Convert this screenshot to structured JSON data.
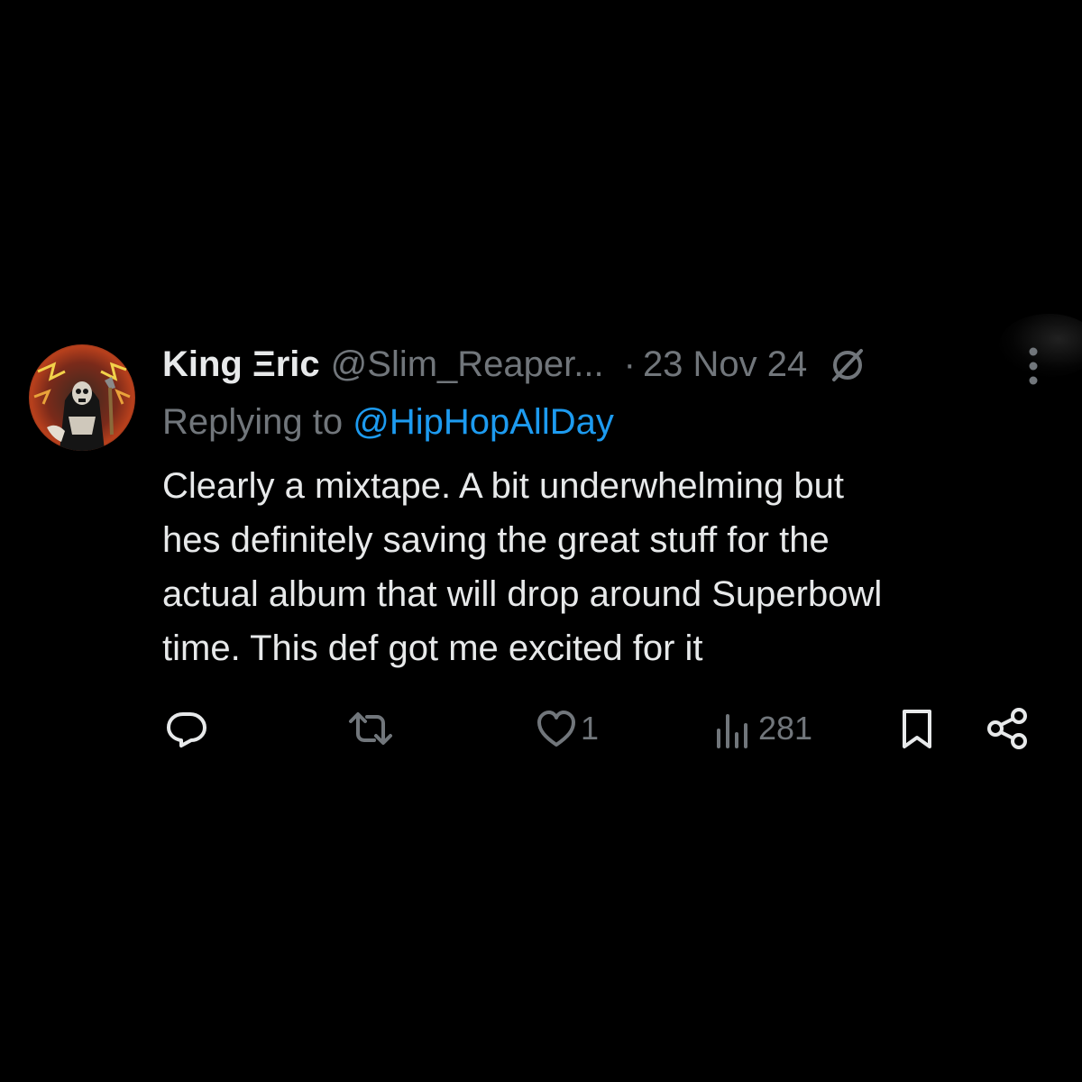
{
  "tweet": {
    "display_name": "King Ξric",
    "handle": "@Slim_Reaper...",
    "separator": "·",
    "date": "23 Nov 24",
    "reply_prefix": "Replying to",
    "reply_target": "@HipHopAllDay",
    "body_lines": [
      "Clearly a mixtape. A bit underwhelming but",
      "hes definitely saving the great stuff for the",
      "actual album that will drop around Superbowl",
      "time. This def got me excited for it"
    ]
  },
  "actions": {
    "reply": {
      "icon": "reply-icon"
    },
    "repost": {
      "icon": "repost-icon"
    },
    "like": {
      "icon": "heart-icon",
      "count": "1"
    },
    "views": {
      "icon": "views-icon",
      "count": "281"
    },
    "bookmark": {
      "icon": "bookmark-icon"
    },
    "share": {
      "icon": "share-icon"
    }
  },
  "icons": {
    "grok": "grok-icon",
    "more": "more-vertical-icon"
  },
  "colors": {
    "background": "#000000",
    "text_primary": "#e7e9ea",
    "text_secondary": "#71767b",
    "link": "#1d9bf0"
  }
}
